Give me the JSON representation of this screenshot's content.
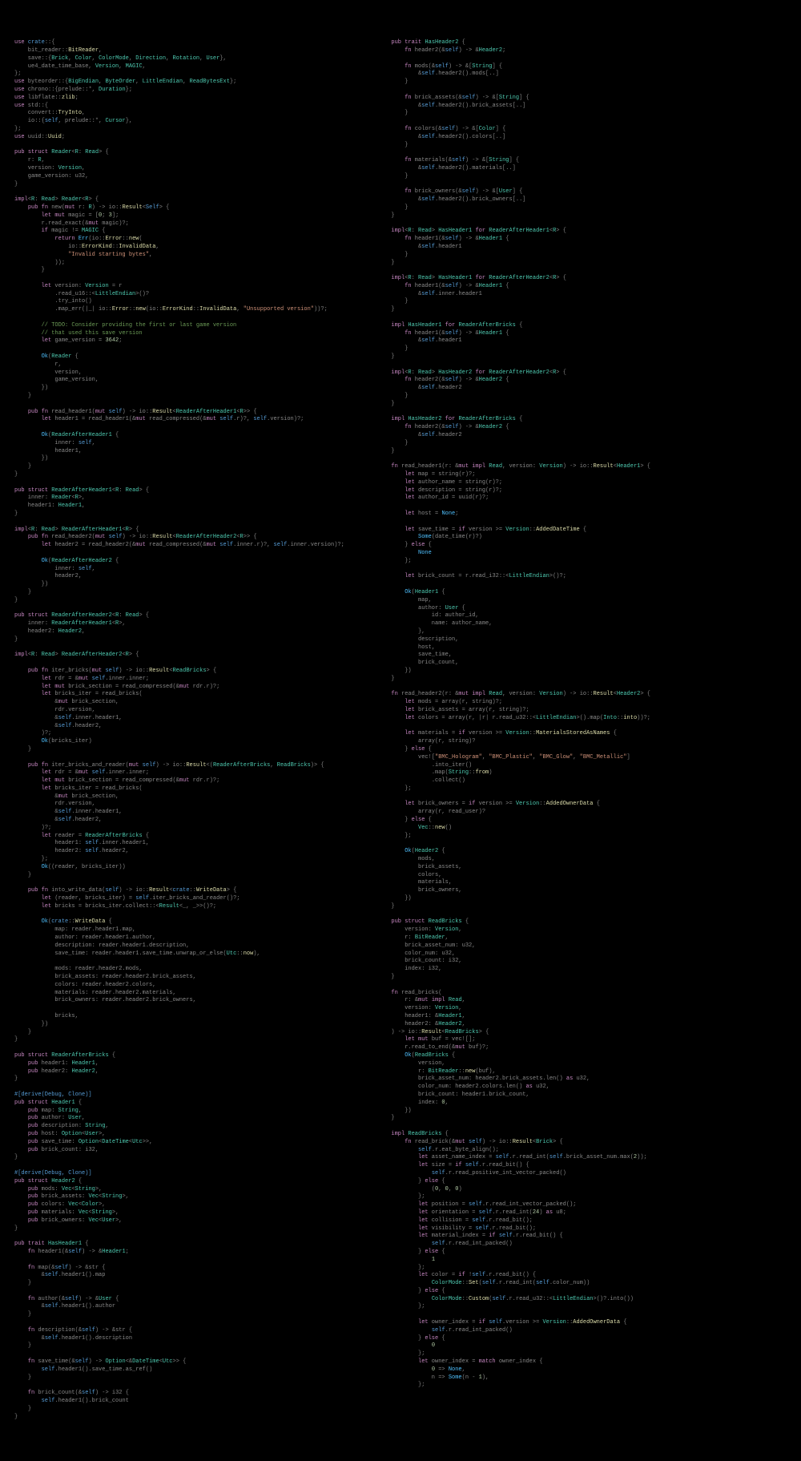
{
  "left": "use crate::{\n    bit_reader::BitReader,\n    save::{Brick, Color, ColorMode, Direction, Rotation, User},\n    ue4_date_time_base, Version, MAGIC,\n};\nuse byteorder::{BigEndian, ByteOrder, LittleEndian, ReadBytesExt};\nuse chrono::{prelude::*, Duration};\nuse libflate::zlib;\nuse std::{\n    convert::TryInto,\n    io::{self, prelude::*, Cursor},\n};\nuse uuid::Uuid;\n\npub struct Reader<R: Read> {\n    r: R,\n    version: Version,\n    game_version: u32,\n}\n\nimpl<R: Read> Reader<R> {\n    pub fn new(mut r: R) -> io::Result<Self> {\n        let mut magic = [0; 3];\n        r.read_exact(&mut magic)?;\n        if magic != MAGIC {\n            return Err(io::Error::new(\n                io::ErrorKind::InvalidData,\n                \"Invalid starting bytes\",\n            ));\n        }\n\n        let version: Version = r\n            .read_u16::<LittleEndian>()?\n            .try_into()\n            .map_err(|_| io::Error::new(io::ErrorKind::InvalidData, \"Unsupported version\"))?;\n\n        // TODO: Consider providing the first or last game version\n        // that used this save version\n        let game_version = 3642;\n\n        Ok(Reader {\n            r,\n            version,\n            game_version,\n        })\n    }\n\n    pub fn read_header1(mut self) -> io::Result<ReaderAfterHeader1<R>> {\n        let header1 = read_header1(&mut read_compressed(&mut self.r)?, self.version)?;\n\n        Ok(ReaderAfterHeader1 {\n            inner: self,\n            header1,\n        })\n    }\n}\n\npub struct ReaderAfterHeader1<R: Read> {\n    inner: Reader<R>,\n    header1: Header1,\n}\n\nimpl<R: Read> ReaderAfterHeader1<R> {\n    pub fn read_header2(mut self) -> io::Result<ReaderAfterHeader2<R>> {\n        let header2 = read_header2(&mut read_compressed(&mut self.inner.r)?, self.inner.version)?;\n\n        Ok(ReaderAfterHeader2 {\n            inner: self,\n            header2,\n        })\n    }\n}\n\npub struct ReaderAfterHeader2<R: Read> {\n    inner: ReaderAfterHeader1<R>,\n    header2: Header2,\n}\n\nimpl<R: Read> ReaderAfterHeader2<R> {\n\n    pub fn iter_bricks(mut self) -> io::Result<ReadBricks> {\n        let rdr = &mut self.inner.inner;\n        let mut brick_section = read_compressed(&mut rdr.r)?;\n        let bricks_iter = read_bricks(\n            &mut brick_section,\n            rdr.version,\n            &self.inner.header1,\n            &self.header2,\n        )?;\n        Ok(bricks_iter)\n    }\n\n    pub fn iter_bricks_and_reader(mut self) -> io::Result<(ReaderAfterBricks, ReadBricks)> {\n        let rdr = &mut self.inner.inner;\n        let mut brick_section = read_compressed(&mut rdr.r)?;\n        let bricks_iter = read_bricks(\n            &mut brick_section,\n            rdr.version,\n            &self.inner.header1,\n            &self.header2,\n        )?;\n        let reader = ReaderAfterBricks {\n            header1: self.inner.header1,\n            header2: self.header2,\n        };\n        Ok((reader, bricks_iter))\n    }\n\n    pub fn into_write_data(self) -> io::Result<crate::WriteData> {\n        let (reader, bricks_iter) = self.iter_bricks_and_reader()?;\n        let bricks = bricks_iter.collect::<Result<_, _>>()?;\n\n        Ok(crate::WriteData {\n            map: reader.header1.map,\n            author: reader.header1.author,\n            description: reader.header1.description,\n            save_time: reader.header1.save_time.unwrap_or_else(Utc::now),\n\n            mods: reader.header2.mods,\n            brick_assets: reader.header2.brick_assets,\n            colors: reader.header2.colors,\n            materials: reader.header2.materials,\n            brick_owners: reader.header2.brick_owners,\n\n            bricks,\n        })\n    }\n}\n\npub struct ReaderAfterBricks {\n    pub header1: Header1,\n    pub header2: Header2,\n}\n\n#[derive(Debug, Clone)]\npub struct Header1 {\n    pub map: String,\n    pub author: User,\n    pub description: String,\n    pub host: Option<User>,\n    pub save_time: Option<DateTime<Utc>>,\n    pub brick_count: i32,\n}\n\n#[derive(Debug, Clone)]\npub struct Header2 {\n    pub mods: Vec<String>,\n    pub brick_assets: Vec<String>,\n    pub colors: Vec<Color>,\n    pub materials: Vec<String>,\n    pub brick_owners: Vec<User>,\n}\n\npub trait HasHeader1 {\n    fn header1(&self) -> &Header1;\n\n    fn map(&self) -> &str {\n        &self.header1().map\n    }\n\n    fn author(&self) -> &User {\n        &self.header1().author\n    }\n\n    fn description(&self) -> &str {\n        &self.header1().description\n    }\n\n    fn save_time(&self) -> Option<&DateTime<Utc>> {\n        self.header1().save_time.as_ref()\n    }\n\n    fn brick_count(&self) -> i32 {\n        self.header1().brick_count\n    }\n}",
  "right": "pub trait HasHeader2 {\n    fn header2(&self) -> &Header2;\n\n    fn mods(&self) -> &[String] {\n        &self.header2().mods[..]\n    }\n\n    fn brick_assets(&self) -> &[String] {\n        &self.header2().brick_assets[..]\n    }\n\n    fn colors(&self) -> &[Color] {\n        &self.header2().colors[..]\n    }\n\n    fn materials(&self) -> &[String] {\n        &self.header2().materials[..]\n    }\n\n    fn brick_owners(&self) -> &[User] {\n        &self.header2().brick_owners[..]\n    }\n}\n\nimpl<R: Read> HasHeader1 for ReaderAfterHeader1<R> {\n    fn header1(&self) -> &Header1 {\n        &self.header1\n    }\n}\n\nimpl<R: Read> HasHeader1 for ReaderAfterHeader2<R> {\n    fn header1(&self) -> &Header1 {\n        &self.inner.header1\n    }\n}\n\nimpl HasHeader1 for ReaderAfterBricks {\n    fn header1(&self) -> &Header1 {\n        &self.header1\n    }\n}\n\nimpl<R: Read> HasHeader2 for ReaderAfterHeader2<R> {\n    fn header2(&self) -> &Header2 {\n        &self.header2\n    }\n}\n\nimpl HasHeader2 for ReaderAfterBricks {\n    fn header2(&self) -> &Header2 {\n        &self.header2\n    }\n}\n\nfn read_header1(r: &mut impl Read, version: Version) -> io::Result<Header1> {\n    let map = string(r)?;\n    let author_name = string(r)?;\n    let description = string(r)?;\n    let author_id = uuid(r)?;\n\n    let host = None;\n\n    let save_time = if version >= Version::AddedDateTime {\n        Some(date_time(r)?)\n    } else {\n        None\n    };\n\n    let brick_count = r.read_i32::<LittleEndian>()?;\n\n    Ok(Header1 {\n        map,\n        author: User {\n            id: author_id,\n            name: author_name,\n        },\n        description,\n        host,\n        save_time,\n        brick_count,\n    })\n}\n\nfn read_header2(r: &mut impl Read, version: Version) -> io::Result<Header2> {\n    let mods = array(r, string)?;\n    let brick_assets = array(r, string)?;\n    let colors = array(r, |r| r.read_u32::<LittleEndian>().map(Into::into))?;\n\n    let materials = if version >= Version::MaterialsStoredAsNames {\n        array(r, string)?\n    } else {\n        vec![\"BMC_Hologram\", \"BMC_Plastic\", \"BMC_Glow\", \"BMC_Metallic\"]\n            .into_iter()\n            .map(String::from)\n            .collect()\n    };\n\n    let brick_owners = if version >= Version::AddedOwnerData {\n        array(r, read_user)?\n    } else {\n        Vec::new()\n    };\n\n    Ok(Header2 {\n        mods,\n        brick_assets,\n        colors,\n        materials,\n        brick_owners,\n    })\n}\n\npub struct ReadBricks {\n    version: Version,\n    r: BitReader,\n    brick_asset_num: u32,\n    color_num: u32,\n    brick_count: i32,\n    index: i32,\n}\n\nfn read_bricks(\n    r: &mut impl Read,\n    version: Version,\n    header1: &Header1,\n    header2: &Header2,\n) -> io::Result<ReadBricks> {\n    let mut buf = vec![];\n    r.read_to_end(&mut buf)?;\n    Ok(ReadBricks {\n        version,\n        r: BitReader::new(buf),\n        brick_asset_num: header2.brick_assets.len() as u32,\n        color_num: header2.colors.len() as u32,\n        brick_count: header1.brick_count,\n        index: 0,\n    })\n}\n\nimpl ReadBricks {\n    fn read_brick(&mut self) -> io::Result<Brick> {\n        self.r.eat_byte_align();\n        let asset_name_index = self.r.read_int(self.brick_asset_num.max(2));\n        let size = if self.r.read_bit() {\n            self.r.read_positive_int_vector_packed()\n        } else {\n            (0, 0, 0)\n        };\n        let position = self.r.read_int_vector_packed();\n        let orientation = self.r.read_int(24) as u8;\n        let collision = self.r.read_bit();\n        let visibility = self.r.read_bit();\n        let material_index = if self.r.read_bit() {\n            self.r.read_int_packed()\n        } else {\n            1\n        };\n        let color = if !self.r.read_bit() {\n            ColorMode::Set(self.r.read_int(self.color_num))\n        } else {\n            ColorMode::Custom(self.r.read_u32::<LittleEndian>()?.into())\n        };\n\n        let owner_index = if self.version >= Version::AddedOwnerData {\n            self.r.read_int_packed()\n        } else {\n            0\n        };\n        let owner_index = match owner_index {\n            0 => None,\n            n => Some(n - 1),\n        };"
}
